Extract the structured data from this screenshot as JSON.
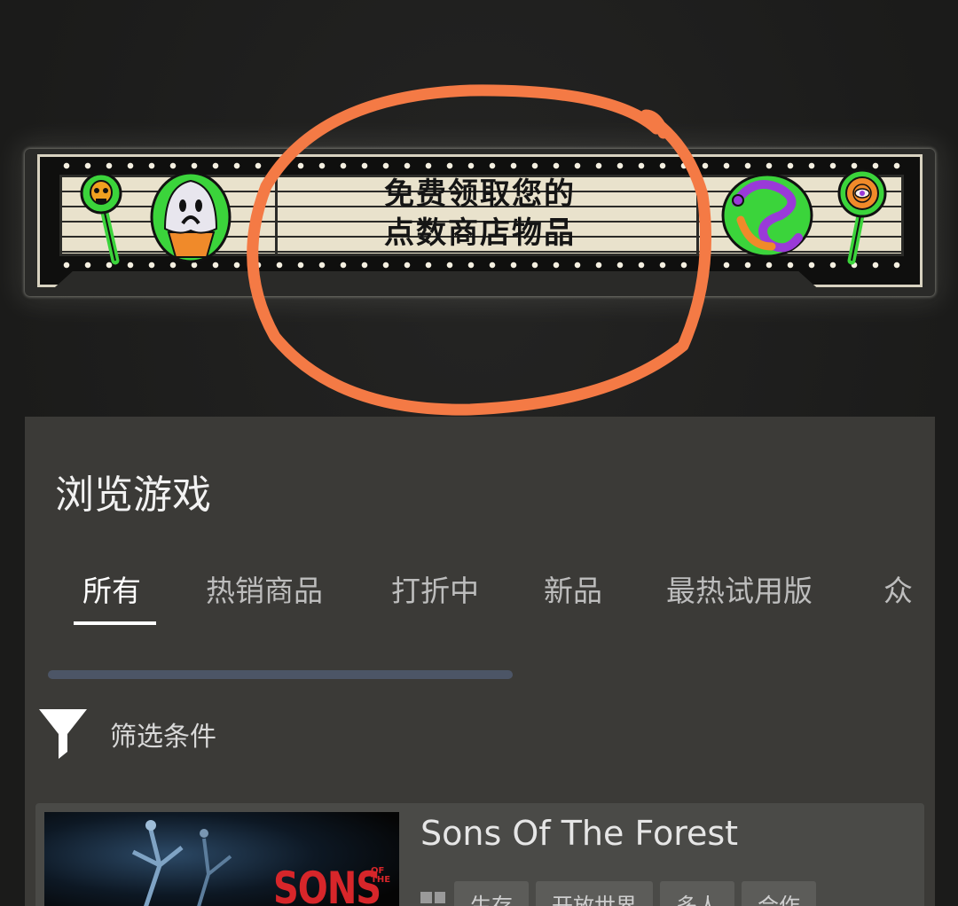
{
  "banner": {
    "line1": "免费领取您的",
    "line2": "点数商店物品"
  },
  "browse": {
    "title": "浏览游戏",
    "tabs": [
      {
        "label": "所有",
        "active": true
      },
      {
        "label": "热销商品",
        "active": false
      },
      {
        "label": "打折中",
        "active": false
      },
      {
        "label": "新品",
        "active": false
      },
      {
        "label": "最热试用版",
        "active": false
      },
      {
        "label": "众",
        "active": false
      }
    ],
    "filter_label": "筛选条件"
  },
  "game": {
    "title": "Sons Of The Forest",
    "logo_text": "SONS",
    "logo_sub": "OF THE",
    "tags": [
      "生存",
      "开放世界",
      "多人",
      "合作"
    ]
  },
  "colors": {
    "annotation": "#f47a45",
    "background": "#1d1d1c",
    "panel": "#3b3a37",
    "scroll_track": "#4c5566"
  },
  "icons": [
    "filter-icon",
    "windows-icon"
  ]
}
